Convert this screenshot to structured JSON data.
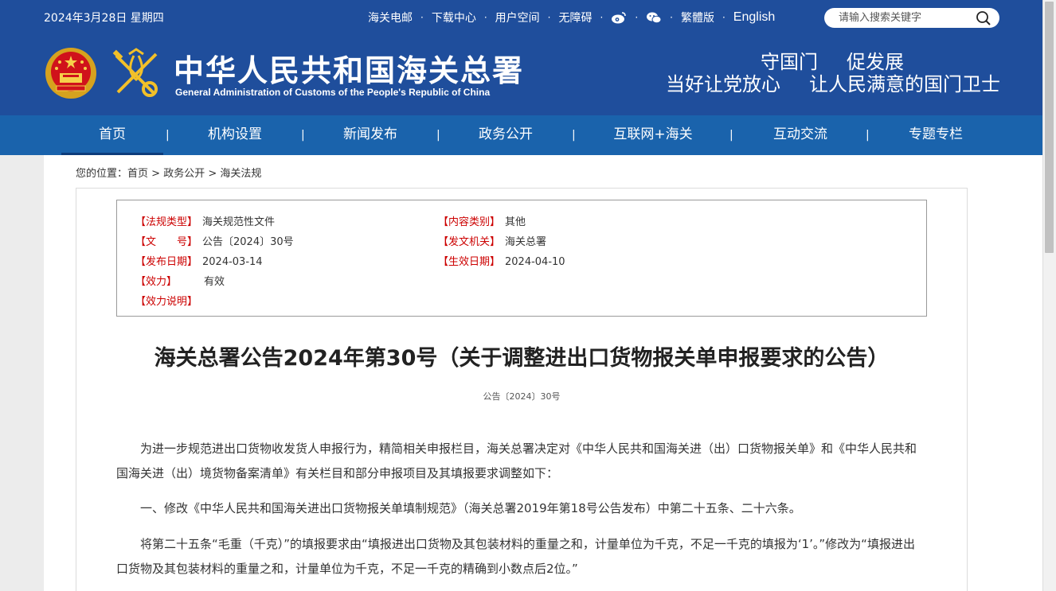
{
  "header": {
    "date": "2024年3月28日 星期四",
    "links": [
      "海关电邮",
      "下载中心",
      "用户空间",
      "无障碍"
    ],
    "lang_links": [
      "繁體版",
      "English"
    ],
    "search_placeholder": "请输入搜索关键字",
    "brand_cn": "中华人民共和国海关总署",
    "brand_en": "General Administration of Customs of the People's Republic of China",
    "slogan_line1": [
      "守国门",
      "促发展"
    ],
    "slogan_line2": [
      "当好让党放心",
      "让人民满意的国门卫士"
    ],
    "icons": [
      "weibo-icon",
      "wechat-icon",
      "search-icon",
      "national-emblem-icon",
      "customs-key-logo-icon"
    ]
  },
  "nav": {
    "items": [
      "首页",
      "机构设置",
      "新闻发布",
      "政务公开",
      "互联网+海关",
      "互动交流",
      "专题专栏"
    ],
    "active": "首页",
    "separator": "|"
  },
  "breadcrumb": {
    "prefix": "您的位置：",
    "items": [
      "首页",
      "政务公开",
      "海关法规"
    ],
    "separator": ">"
  },
  "meta": {
    "left": [
      {
        "label": "【法规类型】",
        "value": "海关规范性文件"
      },
      {
        "label": "【文　　号】",
        "value": "公告〔2024〕30号"
      },
      {
        "label": "【发布日期】",
        "value": "2024-03-14"
      },
      {
        "label": "【效力】",
        "value": "有效"
      },
      {
        "label": "【效力说明】",
        "value": ""
      }
    ],
    "right": [
      {
        "label": "【内容类别】",
        "value": "其他"
      },
      {
        "label": "【发文机关】",
        "value": "海关总署"
      },
      {
        "label": "【生效日期】",
        "value": "2024-04-10"
      }
    ]
  },
  "article": {
    "title": "海关总署公告2024年第30号（关于调整进出口货物报关单申报要求的公告）",
    "doc_no": "公告〔2024〕30号",
    "paragraphs": [
      "　　为进一步规范进出口货物收发货人申报行为，精简相关申报栏目，海关总署决定对《中华人民共和国海关进（出）口货物报关单》和《中华人民共和国海关进（出）境货物备案清单》有关栏目和部分申报项目及其填报要求调整如下：",
      "　　一、修改《中华人民共和国海关进出口货物报关单填制规范》（海关总署2019年第18号公告发布）中第二十五条、二十六条。",
      "　　将第二十五条“毛重（千克）”的填报要求由“填报进出口货物及其包装材料的重量之和，计量单位为千克，不足一千克的填报为‘1’。”修改为“填报进出口货物及其包装材料的重量之和，计量单位为千克，不足一千克的精确到小数点后2位。”"
    ]
  },
  "colors": {
    "header_bg": "#1f4e9c",
    "nav_bg": "#1a63ac",
    "meta_label": "#cc0000"
  }
}
